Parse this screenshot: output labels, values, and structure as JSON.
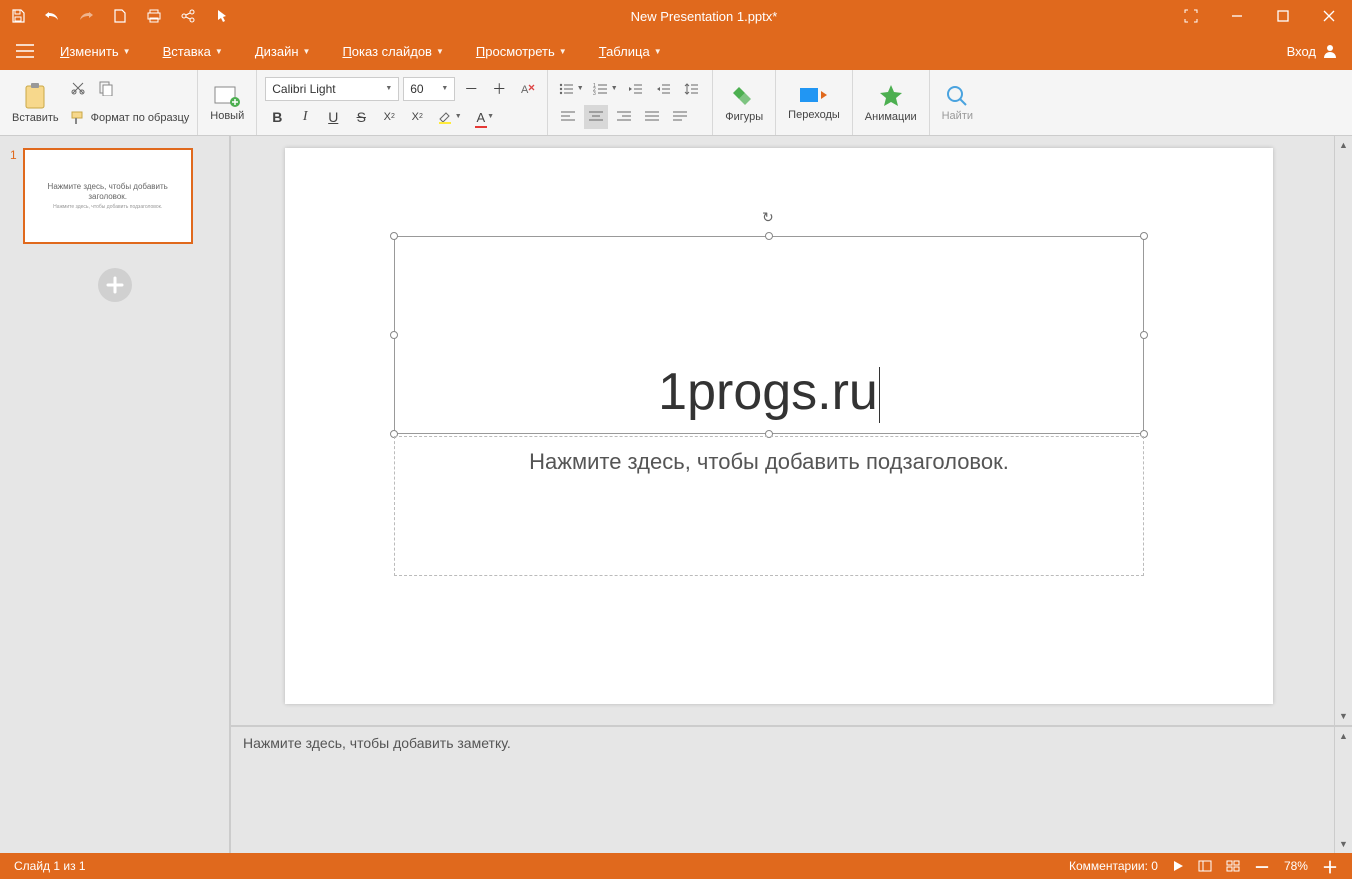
{
  "title": "New Presentation 1.pptx*",
  "menu": {
    "edit": "Изменить",
    "insert": "Вставка",
    "design": "Дизайн",
    "slideshow": "Показ слайдов",
    "view": "Просмотреть",
    "table": "Таблица",
    "login": "Вход"
  },
  "ribbon": {
    "paste": "Вставить",
    "format_painter": "Формат по образцу",
    "new_slide": "Новый",
    "font_name": "Calibri Light",
    "font_size": "60",
    "shapes": "Фигуры",
    "transitions": "Переходы",
    "animations": "Анимации",
    "find": "Найти"
  },
  "thumb": {
    "number": "1",
    "title_ph": "Нажмите здесь, чтобы добавить заголовок.",
    "subtitle_ph": "Нажмите здесь, чтобы добавить подзаголовок."
  },
  "slide": {
    "title_text": "1progs.ru",
    "subtitle_ph": "Нажмите здесь, чтобы добавить подзаголовок."
  },
  "notes_ph": "Нажмите здесь, чтобы добавить заметку.",
  "status": {
    "slide_counter": "Слайд 1 из 1",
    "comments": "Комментарии: 0",
    "zoom": "78%"
  }
}
